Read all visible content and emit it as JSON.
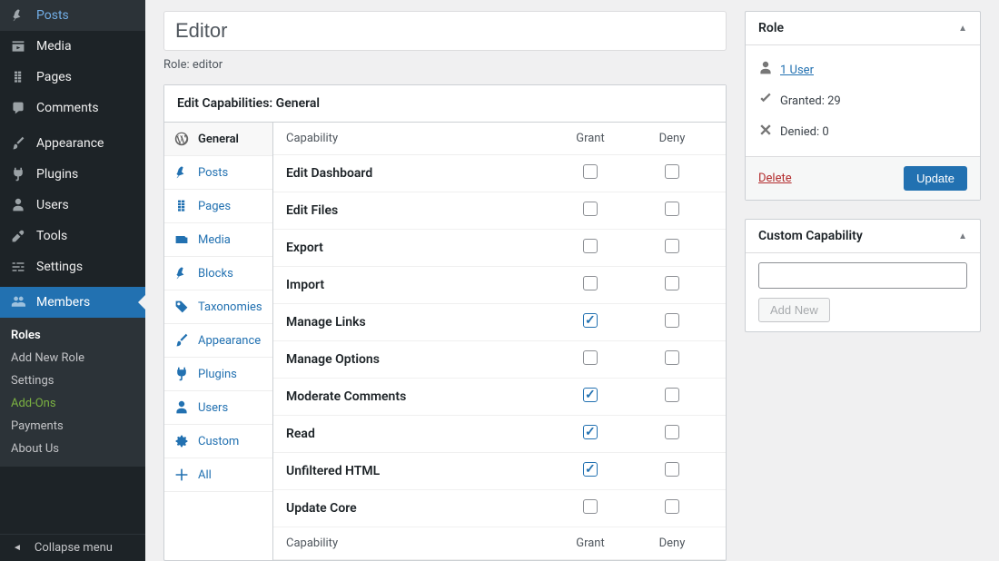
{
  "sidebar": {
    "items": [
      {
        "label": "Posts",
        "icon": "pin"
      },
      {
        "label": "Media",
        "icon": "media"
      },
      {
        "label": "Pages",
        "icon": "page"
      },
      {
        "label": "Comments",
        "icon": "chat"
      }
    ],
    "items2": [
      {
        "label": "Appearance",
        "icon": "brush"
      },
      {
        "label": "Plugins",
        "icon": "plug"
      },
      {
        "label": "Users",
        "icon": "user"
      },
      {
        "label": "Tools",
        "icon": "wrench"
      },
      {
        "label": "Settings",
        "icon": "sliders"
      }
    ],
    "members": {
      "label": "Members",
      "icon": "group"
    },
    "sub": [
      {
        "label": "Roles",
        "active": true
      },
      {
        "label": "Add New Role"
      },
      {
        "label": "Settings"
      },
      {
        "label": "Add-Ons",
        "green": true
      },
      {
        "label": "Payments"
      },
      {
        "label": "About Us"
      }
    ],
    "collapse": "Collapse menu"
  },
  "editor": {
    "title_value": "Editor",
    "role_prefix": "Role: ",
    "role_name": "editor",
    "box_title": "Edit Capabilities: General",
    "tabs": [
      {
        "label": "General",
        "icon": "wp",
        "active": true
      },
      {
        "label": "Posts",
        "icon": "pin"
      },
      {
        "label": "Pages",
        "icon": "page"
      },
      {
        "label": "Media",
        "icon": "media2"
      },
      {
        "label": "Blocks",
        "icon": "pin"
      },
      {
        "label": "Taxonomies",
        "icon": "tag"
      },
      {
        "label": "Appearance",
        "icon": "brush"
      },
      {
        "label": "Plugins",
        "icon": "plug"
      },
      {
        "label": "Users",
        "icon": "user"
      },
      {
        "label": "Custom",
        "icon": "gear"
      },
      {
        "label": "All",
        "icon": "plus"
      }
    ],
    "head": {
      "cap": "Capability",
      "grant": "Grant",
      "deny": "Deny"
    },
    "caps": [
      {
        "label": "Edit Dashboard",
        "grant": false,
        "deny": false
      },
      {
        "label": "Edit Files",
        "grant": false,
        "deny": false
      },
      {
        "label": "Export",
        "grant": false,
        "deny": false
      },
      {
        "label": "Import",
        "grant": false,
        "deny": false
      },
      {
        "label": "Manage Links",
        "grant": true,
        "deny": false
      },
      {
        "label": "Manage Options",
        "grant": false,
        "deny": false
      },
      {
        "label": "Moderate Comments",
        "grant": true,
        "deny": false
      },
      {
        "label": "Read",
        "grant": true,
        "deny": false
      },
      {
        "label": "Unfiltered HTML",
        "grant": true,
        "deny": false
      },
      {
        "label": "Update Core",
        "grant": false,
        "deny": false
      }
    ]
  },
  "rolebox": {
    "title": "Role",
    "user_link": "1 User",
    "granted": "Granted: 29",
    "denied": "Denied: 0",
    "delete": "Delete",
    "update": "Update"
  },
  "custom": {
    "title": "Custom Capability",
    "add": "Add New"
  }
}
